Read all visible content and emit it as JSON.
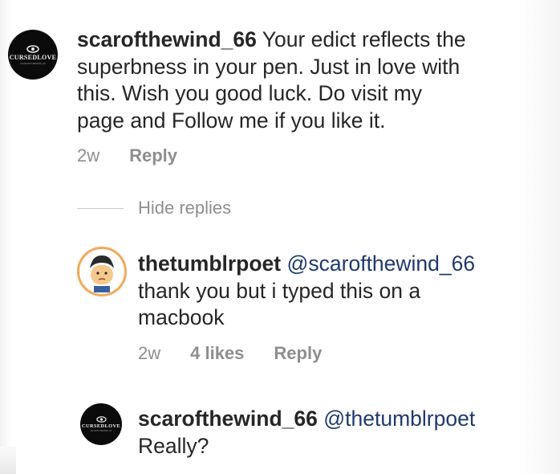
{
  "comment1": {
    "avatar_brand": "CURSEDLOVE",
    "avatar_sub": "SCAROFTHEWIND_66",
    "username": "scarofthewind_66",
    "text_line1": "Your edict reflects the",
    "text_line2": "superbness in your pen. Just in love with",
    "text_line3": "this. Wish you good luck. Do visit my",
    "text_line4": "page and Follow me if you like it.",
    "time": "2w",
    "reply_label": "Reply"
  },
  "hide_replies_label": "Hide replies",
  "reply1": {
    "username": "thetumblrpoet",
    "mention": "@scarofthewind_66",
    "text_line2": "thank you but i typed this on a",
    "text_line3": "macbook",
    "time": "2w",
    "likes": "4 likes",
    "reply_label": "Reply"
  },
  "reply2": {
    "avatar_brand": "CURSEDLOVE",
    "avatar_sub": "SCAROFTHEWIND_66",
    "username": "scarofthewind_66",
    "mention": "@thetumblrpoet",
    "text_line2": "Really?"
  },
  "colors": {
    "text": "#262626",
    "muted": "#8e8e8e",
    "mention": "#1e3a6e",
    "avatar_ring": "#f2a95b"
  }
}
